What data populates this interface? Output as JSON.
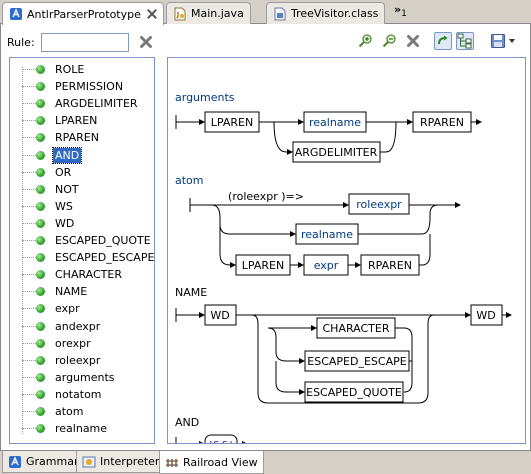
{
  "editor_tabs": [
    {
      "label": "AntlrParserPrototype",
      "icon": "antlr-grammar-icon",
      "active": true,
      "closable": true
    },
    {
      "label": "Main.java",
      "icon": "java-file-icon",
      "active": false
    },
    {
      "label": "TreeVisitor.class",
      "icon": "class-file-icon",
      "active": false
    }
  ],
  "tab_overflow": {
    "symbol": "»",
    "count": "1"
  },
  "rule_filter": {
    "label": "Rule:",
    "value": "",
    "placeholder": ""
  },
  "toolbar": {
    "icons": [
      "zoom-in-icon",
      "zoom-out-icon",
      "clear-icon",
      "link-icon",
      "tree-layout-icon",
      "save-icon",
      "dropdown-icon"
    ]
  },
  "rules": [
    "ROLE",
    "PERMISSION",
    "ARGDELIMITER",
    "LPAREN",
    "RPAREN",
    "AND",
    "OR",
    "NOT",
    "WS",
    "WD",
    "ESCAPED_QUOTE",
    "ESCAPED_ESCAPE",
    "CHARACTER",
    "NAME",
    "expr",
    "andexpr",
    "orexpr",
    "roleexpr",
    "arguments",
    "notatom",
    "atom",
    "realname"
  ],
  "selected_rule": "AND",
  "diagram": {
    "arguments": {
      "name": "arguments",
      "lparen": "LPAREN",
      "realname": "realname",
      "argdelimiter": "ARGDELIMITER",
      "rparen": "RPAREN"
    },
    "atom": {
      "name": "atom",
      "predicate": "(roleexpr )=>",
      "roleexpr": "roleexpr",
      "realname": "realname",
      "lparen": "LPAREN",
      "expr": "expr",
      "rparen": "RPAREN"
    },
    "name_rule": {
      "name": "NAME",
      "wd_left": "WD",
      "character": "CHARACTER",
      "escaped_escape": "ESCAPED_ESCAPE",
      "escaped_quote": "ESCAPED_QUOTE",
      "wd_right": "WD"
    },
    "and_rule": {
      "name": "AND",
      "literal": "'&&'"
    }
  },
  "view_tabs": [
    {
      "label": "Grammar",
      "icon": "grammar-icon",
      "active": false
    },
    {
      "label": "Interpreter",
      "icon": "interpreter-icon",
      "active": false
    },
    {
      "label": "Railroad View",
      "icon": "railroad-icon",
      "active": true
    }
  ],
  "colors": {
    "selection": "#316ac5",
    "rule_dot": "#36a832",
    "rule_ref_text": "#003a80",
    "literal_text": "#5a0a8a"
  }
}
